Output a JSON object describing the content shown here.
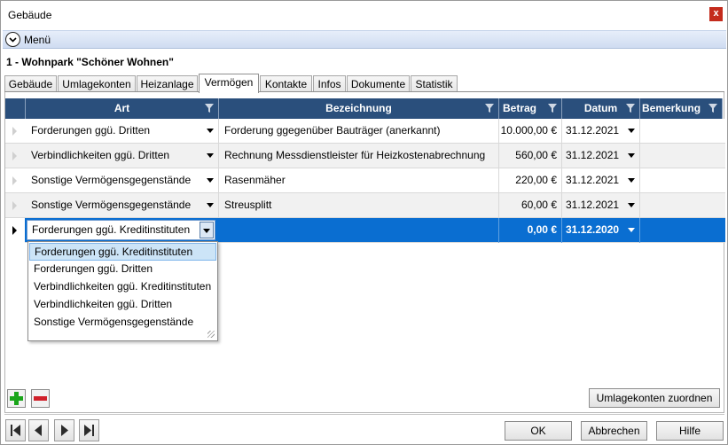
{
  "window": {
    "title": "Gebäude",
    "close_label": "x"
  },
  "menu": {
    "label": "Menü"
  },
  "heading": "1 - Wohnpark \"Schöner Wohnen\"",
  "tabs": [
    {
      "label": "Gebäude"
    },
    {
      "label": "Umlagekonten"
    },
    {
      "label": "Heizanlage"
    },
    {
      "label": "Vermögen",
      "active": true
    },
    {
      "label": "Kontakte"
    },
    {
      "label": "Infos"
    },
    {
      "label": "Dokumente"
    },
    {
      "label": "Statistik"
    }
  ],
  "grid": {
    "columns": [
      {
        "label": "Art",
        "filter_icon": "funnel-icon"
      },
      {
        "label": "Bezeichnung",
        "filter_icon": "funnel-icon"
      },
      {
        "label": "Betrag",
        "filter_icon": "funnel-icon"
      },
      {
        "label": "Datum",
        "filter_icon": "funnel-icon"
      },
      {
        "label": "Bemerkung",
        "filter_icon": "funnel-icon"
      }
    ],
    "rows": [
      {
        "art": "Forderungen ggü. Dritten",
        "bezeichnung": "Forderung ggegenüber Bauträger (anerkannt)",
        "betrag": "10.000,00 €",
        "datum": "31.12.2021",
        "bemerkung": ""
      },
      {
        "art": "Verbindlichkeiten ggü. Dritten",
        "bezeichnung": "Rechnung Messdienstleister für Heizkostenabrechnung",
        "betrag": "560,00 €",
        "datum": "31.12.2021",
        "bemerkung": ""
      },
      {
        "art": "Sonstige Vermögensgegenstände",
        "bezeichnung": "Rasenmäher",
        "betrag": "220,00 €",
        "datum": "31.12.2021",
        "bemerkung": ""
      },
      {
        "art": "Sonstige Vermögensgegenstände",
        "bezeichnung": "Streusplitt",
        "betrag": "60,00 €",
        "datum": "31.12.2021",
        "bemerkung": ""
      }
    ],
    "new_row": {
      "art": "Forderungen ggü. Kreditinstituten",
      "bezeichnung": "",
      "betrag": "0,00 €",
      "datum": "31.12.2020",
      "bemerkung": ""
    },
    "dropdown_options": [
      "Forderungen ggü. Kreditinstituten",
      "Forderungen ggü. Dritten",
      "Verbindlichkeiten ggü. Kreditinstituten",
      "Verbindlichkeiten ggü. Dritten",
      "Sonstige Vermögensgegenstände"
    ]
  },
  "actions": {
    "add_icon": "plus-icon",
    "remove_icon": "minus-icon",
    "assign_label": "Umlagekonten zuordnen"
  },
  "footer": {
    "ok_label": "OK",
    "cancel_label": "Abbrechen",
    "help_label": "Hilfe",
    "nav_icons": [
      "first-record-icon",
      "previous-record-icon",
      "next-record-icon",
      "last-record-icon"
    ]
  },
  "colors": {
    "header_bg": "#2a4f7c",
    "selected_row": "#0a6ed1",
    "add_green": "#1aa51a",
    "remove_red": "#d0202a"
  }
}
